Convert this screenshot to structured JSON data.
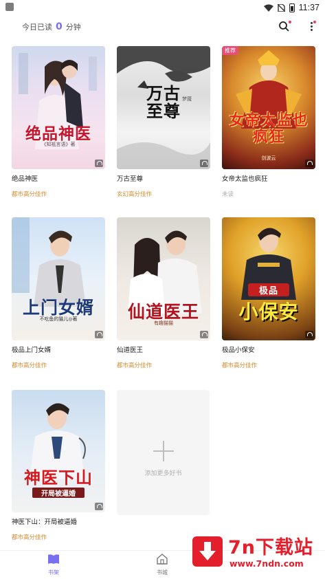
{
  "status_bar": {
    "time": "11:37"
  },
  "header": {
    "read_prefix": "今日已读",
    "read_minutes": "0",
    "read_suffix": "分钟",
    "search_icon": "search-icon",
    "more_icon": "more-vertical-icon"
  },
  "books": [
    {
      "title": "绝品神医",
      "tag": "都市高分佳作",
      "cover_title": "绝品神医",
      "cover_author": "《知祗言语》著",
      "badge": ""
    },
    {
      "title": "万古至尊",
      "tag": "玄幻高分佳作",
      "cover_title": "万古至尊",
      "cover_author": "梦魇",
      "badge": ""
    },
    {
      "title": "女帝太监也疯狂",
      "tag": "未读",
      "cover_title": "女帝太监也疯狂",
      "cover_author": "剑波云",
      "badge": "推荐"
    },
    {
      "title": "极品上门女婿",
      "tag": "都市高分佳作",
      "cover_title": "上门女婿",
      "cover_author": "不吃鱼的猫儿◎著",
      "badge": ""
    },
    {
      "title": "仙道医王",
      "tag": "都市高分佳作",
      "cover_title": "仙道医王",
      "cover_author": "有趣猫猫",
      "badge": ""
    },
    {
      "title": "极品小保安",
      "tag": "都市高分佳作",
      "cover_title": "小保安",
      "cover_author": "极品",
      "badge": ""
    },
    {
      "title": "神医下山：开局被逼婚",
      "tag": "都市高分佳作",
      "cover_title": "神医下山",
      "cover_author": "开局被逼婚",
      "badge": ""
    }
  ],
  "add_more": {
    "label": "添加更多好书"
  },
  "bottom_nav": {
    "shelf_label": "书架",
    "city_label": "书城"
  },
  "watermark": {
    "title": "7n下载站",
    "url": "www.7ndn.com"
  },
  "colors": {
    "accent": "#7a6ff0",
    "tag": "#d98a2c",
    "watermark": "#e21f2b"
  }
}
